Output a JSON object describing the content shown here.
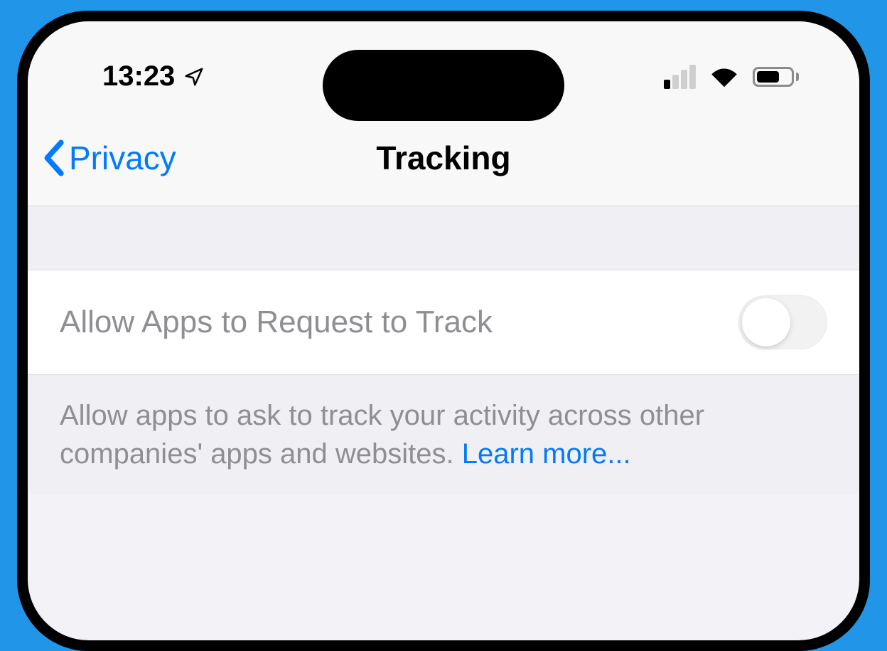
{
  "status": {
    "time": "13:23",
    "location_icon": "location-arrow",
    "cellular_level": 1,
    "wifi": true,
    "battery_pct": 68
  },
  "nav": {
    "back_label": "Privacy",
    "title": "Tracking"
  },
  "settings": {
    "allow_tracking": {
      "label": "Allow Apps to Request to Track",
      "enabled": false
    }
  },
  "footer": {
    "description": "Allow apps to ask to track your activity across other companies' apps and websites. ",
    "learn_more": "Learn more..."
  }
}
